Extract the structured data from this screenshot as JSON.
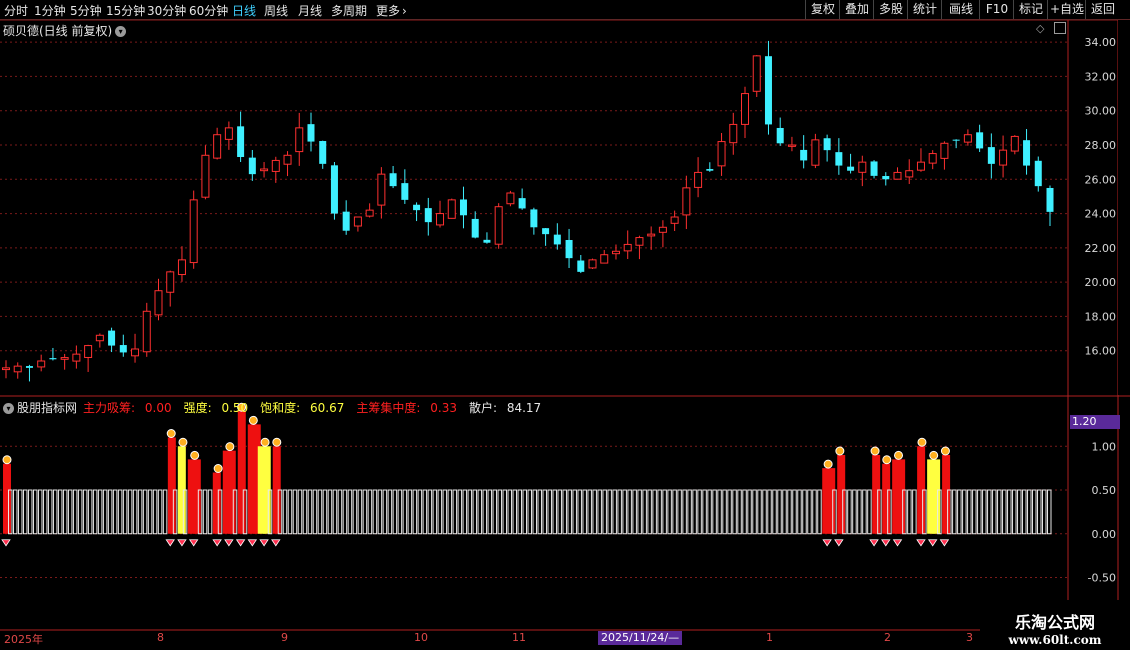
{
  "toolbar": {
    "periods": [
      "分时",
      "1分钟",
      "5分钟",
      "15分钟",
      "30分钟",
      "60分钟",
      "日线",
      "周线",
      "月线",
      "多周期",
      "更多"
    ],
    "active_period": "日线",
    "more_chevron_icon": "chevron-right-icon",
    "buttons": [
      "复权",
      "叠加",
      "多股",
      "统计",
      "画线",
      "F10",
      "标记",
      "+自选",
      "返回"
    ]
  },
  "main_chart": {
    "title": "硕贝德(日线 前复权)",
    "title_chevron_icon": "chevron-down-icon",
    "corner_icons": [
      "diamond-icon",
      "window-icon"
    ],
    "y_ticks": [
      "34.00",
      "32.00",
      "30.00",
      "28.00",
      "26.00",
      "24.00",
      "22.00",
      "20.00",
      "18.00",
      "16.00"
    ],
    "up_color": "#ff3030",
    "down_color": "#3ff0ff"
  },
  "indicator": {
    "name": "股朋指标网",
    "fields": [
      {
        "label": "主力吸筹: ",
        "value": "0.00",
        "color": "#ff2020"
      },
      {
        "label": "强度: ",
        "value": "0.50",
        "color": "#ffff40"
      },
      {
        "label": "饱和度: ",
        "value": "60.67",
        "color": "#ffff40"
      },
      {
        "label": "主筹集中度: ",
        "value": "0.33",
        "color": "#ff2020"
      },
      {
        "label": "散户: ",
        "value": "84.17",
        "color": "#e6e6e6"
      }
    ],
    "current_value_badge": "1.20",
    "y_ticks": [
      "1.00",
      "0.50",
      "0.00",
      "-0.50"
    ]
  },
  "date_axis": {
    "labels": [
      "2025年",
      "8",
      "9",
      "10",
      "11",
      "2025/11/24/—",
      "1",
      "2",
      "3"
    ]
  },
  "watermark": {
    "line1": "乐淘公式网",
    "line2": "www.60lt.com"
  },
  "chart_data": {
    "type": "candlestick",
    "title": "硕贝德(日线 前复权)",
    "ylim": [
      14,
      35
    ],
    "candles_close_approx": [
      15.0,
      15.1,
      15.0,
      15.4,
      15.5,
      15.6,
      15.8,
      16.3,
      16.9,
      16.3,
      15.9,
      16.1,
      18.3,
      19.5,
      20.6,
      21.3,
      24.8,
      27.4,
      28.6,
      29.0,
      27.3,
      26.3,
      26.6,
      27.1,
      27.4,
      29.0,
      28.2,
      26.9,
      24.0,
      23.0,
      23.8,
      24.2,
      26.3,
      25.6,
      24.8,
      24.2,
      23.5,
      24.0,
      24.8,
      23.9,
      22.6,
      22.3,
      24.4,
      25.2,
      24.3,
      23.2,
      22.8,
      22.2,
      21.4,
      20.6,
      21.3,
      21.6,
      21.8,
      22.2,
      22.6,
      22.8,
      23.2,
      23.8,
      25.5,
      26.4,
      26.5,
      28.2,
      29.2,
      31.0,
      33.2,
      29.2,
      28.1,
      28.0,
      27.1,
      28.3,
      27.7,
      26.8,
      26.5,
      27.0,
      26.2,
      26.0,
      26.4,
      26.5,
      27.0,
      27.5,
      28.1,
      28.3,
      28.6,
      27.8,
      26.9,
      27.7,
      28.5,
      26.8,
      25.6,
      24.1
    ],
    "indicator_series": [
      {
        "name": "主力吸筹",
        "color": "#ff2020"
      },
      {
        "name": "强度",
        "color": "#ffff40"
      },
      {
        "name": "饱和度",
        "color": "#ffff40"
      },
      {
        "name": "主筹集中度",
        "color": "#ff2020"
      },
      {
        "name": "散户",
        "color": "#e6e6e6"
      }
    ]
  }
}
